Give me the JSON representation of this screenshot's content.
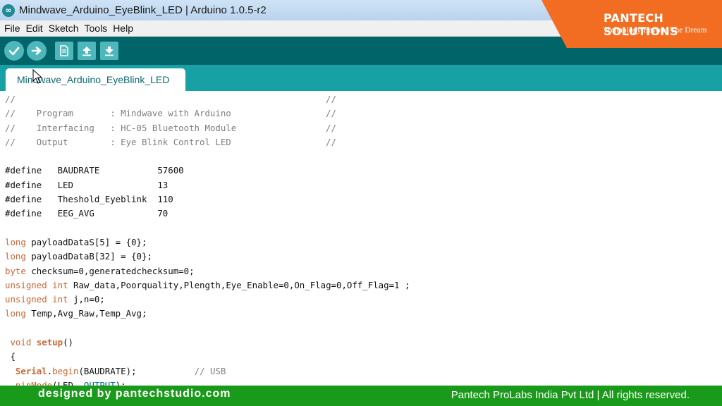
{
  "window": {
    "title": "Mindwave_Arduino_EyeBlink_LED | Arduino 1.0.5-r2",
    "icon": "arduino-logo-icon"
  },
  "menu": [
    "File",
    "Edit",
    "Sketch",
    "Tools",
    "Help"
  ],
  "toolbar": {
    "buttons": [
      "verify-icon",
      "upload-icon",
      "new-icon",
      "open-icon",
      "save-icon"
    ]
  },
  "brand": {
    "name": "PANTECH SOLUTIONS",
    "tagline": "Technology Beyond The Dream",
    "color": "#f26d21"
  },
  "tab": {
    "label": "Mindwave_Arduino_EyeBlink_LED"
  },
  "code": [
    [
      {
        "t": "//                                                           //",
        "c": "comment"
      }
    ],
    [
      {
        "t": "//    Program       : Mindwave with Arduino                  //",
        "c": "comment"
      }
    ],
    [
      {
        "t": "//    Interfacing   : HC-05 Bluetooth Module                 //",
        "c": "comment"
      }
    ],
    [
      {
        "t": "//    Output        : Eye Blink Control LED                  //",
        "c": "comment"
      }
    ],
    [],
    [
      {
        "t": "#define   BAUDRATE           57600"
      }
    ],
    [
      {
        "t": "#define   LED                13"
      }
    ],
    [
      {
        "t": "#define   Theshold_Eyeblink  110"
      }
    ],
    [
      {
        "t": "#define   EEG_AVG            70"
      }
    ],
    [],
    [
      {
        "t": "long",
        "c": "kw"
      },
      {
        "t": " payloadDataS[5] = {0};"
      }
    ],
    [
      {
        "t": "long",
        "c": "kw"
      },
      {
        "t": " payloadDataB[32] = {0};"
      }
    ],
    [
      {
        "t": "byte",
        "c": "kw"
      },
      {
        "t": " checksum=0,generatedchecksum=0;"
      }
    ],
    [
      {
        "t": "unsigned",
        "c": "kw"
      },
      {
        "t": " "
      },
      {
        "t": "int",
        "c": "kw"
      },
      {
        "t": " Raw_data,Poorquality,Plength,Eye_Enable=0,On_Flag=0,Off_Flag=1 ;"
      }
    ],
    [
      {
        "t": "unsigned",
        "c": "kw"
      },
      {
        "t": " "
      },
      {
        "t": "int",
        "c": "kw"
      },
      {
        "t": " j,n=0;"
      }
    ],
    [
      {
        "t": "long",
        "c": "kw"
      },
      {
        "t": " Temp,Avg_Raw,Temp_Avg;"
      }
    ],
    [],
    [
      {
        "t": " "
      },
      {
        "t": "void",
        "c": "kw"
      },
      {
        "t": " "
      },
      {
        "t": "setup",
        "c": "fn"
      },
      {
        "t": "()"
      }
    ],
    [
      {
        "t": " {"
      }
    ],
    [
      {
        "t": "  "
      },
      {
        "t": "Serial",
        "c": "fn"
      },
      {
        "t": "."
      },
      {
        "t": "begin",
        "c": "kw"
      },
      {
        "t": "(BAUDRATE);           "
      },
      {
        "t": "// USB",
        "c": "comment"
      }
    ],
    [
      {
        "t": "  "
      },
      {
        "t": "pinMode",
        "c": "kw"
      },
      {
        "t": "(LED, "
      },
      {
        "t": "OUTPUT",
        "c": "const"
      },
      {
        "t": ");"
      }
    ]
  ],
  "footer": {
    "left": "designed by pantechstudio.com",
    "right": "Pantech ProLabs India Pvt Ltd | All rights reserved."
  },
  "colors": {
    "toolbar": "#006468",
    "tabstrip": "#17a1a5",
    "keyword": "#cc6633",
    "comment": "#7e7e7e",
    "footer": "#1a9a1a"
  }
}
